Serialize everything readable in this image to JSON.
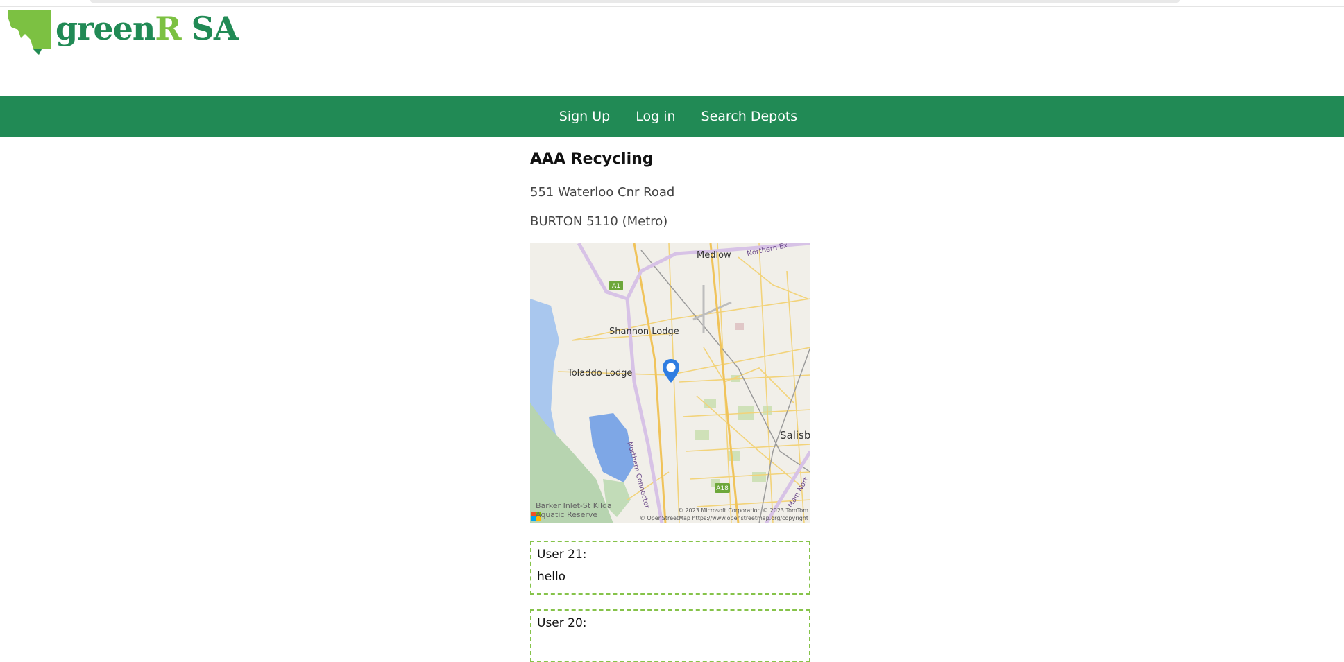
{
  "brand": {
    "name_part1": "green",
    "name_part2": "R",
    "name_part3": " SA",
    "logo_icon": "south-australia-map-icon",
    "primary_color": "#218a55",
    "accent_color": "#7cc142"
  },
  "nav": {
    "items": [
      {
        "label": "Sign Up"
      },
      {
        "label": "Log in"
      },
      {
        "label": "Search Depots"
      }
    ]
  },
  "depot": {
    "name": "AAA Recycling",
    "address_line1": "551 Waterloo Cnr Road",
    "address_line2": "BURTON 5110 (Metro)"
  },
  "map": {
    "labels": {
      "medlow": "Medlow",
      "northern_ex": "Northern Ex",
      "shannon_lodge": "Shannon Lodge",
      "tolaldo_lodge": "Toladdo Lodge",
      "salisb": "Salisb",
      "northern_connector": "Northern Connector",
      "main_north": "Main Nort",
      "a1": "A1",
      "a18": "A18",
      "barker_line1": "Barker Inlet-St Kilda",
      "barker_line2": "Aquatic Reserve"
    },
    "attribution_line1": "© 2023 Microsoft Corporation © 2023 TomTom",
    "attribution_line2": "© OpenStreetMap https://www.openstreetmap.org/copyright",
    "provider": "bing",
    "marker_icon": "map-pin-icon"
  },
  "comments": [
    {
      "user": "User 21:",
      "message": "hello"
    },
    {
      "user": "User 20:",
      "message": ""
    }
  ]
}
